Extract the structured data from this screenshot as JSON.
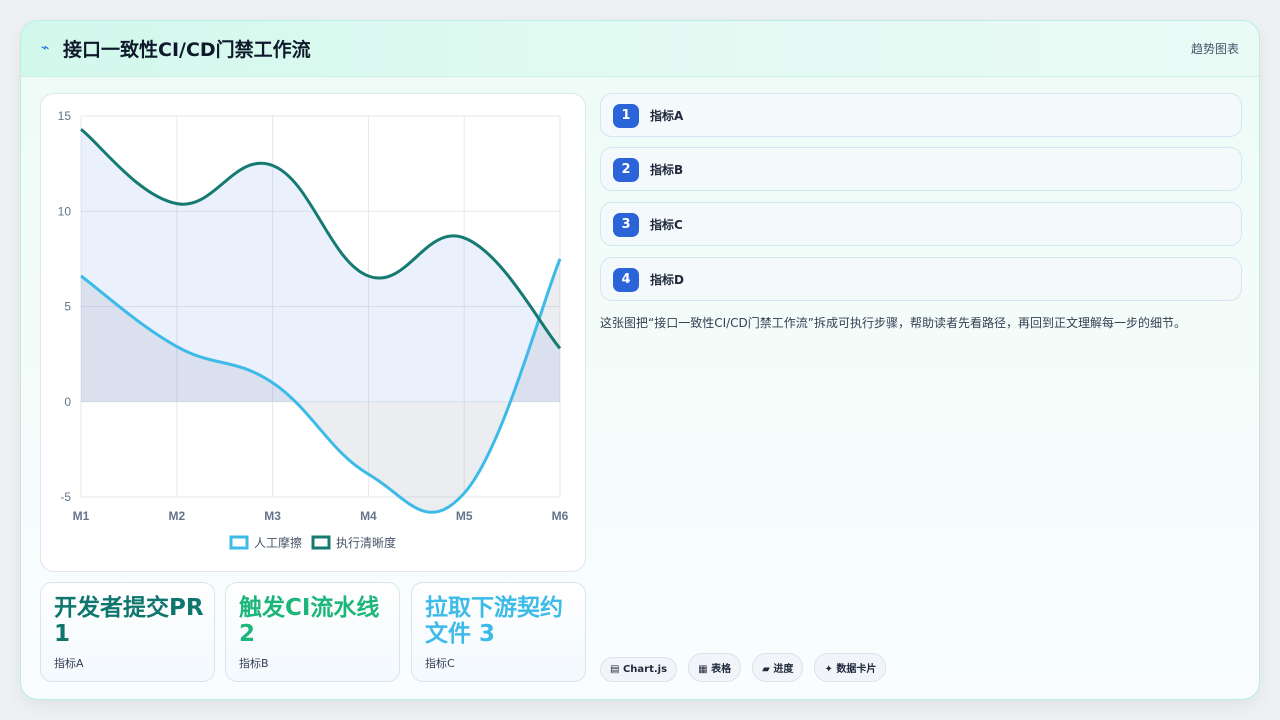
{
  "header": {
    "icon": "bolt-icon",
    "title": "接口一致性CI/CD门禁工作流",
    "tag": "趋势图表"
  },
  "chart_data": {
    "type": "line",
    "categories": [
      "M1",
      "M2",
      "M3",
      "M4",
      "M5",
      "M6"
    ],
    "series": [
      {
        "name": "人工摩擦",
        "values": [
          6.6,
          2.9,
          1.0,
          -3.8,
          -4.8,
          7.5
        ],
        "color": "#3dbbe8",
        "fill": "rgba(120,130,150,0.14)"
      },
      {
        "name": "执行清晰度",
        "values": [
          14.3,
          10.4,
          12.4,
          6.6,
          8.6,
          2.8
        ],
        "color": "#147a72",
        "fill": "rgba(130,160,240,0.16)"
      }
    ],
    "ylim": [
      -5,
      15
    ],
    "yticks": [
      15,
      10,
      5,
      0,
      -5
    ],
    "grid": true,
    "legend": "bottom"
  },
  "stats": [
    {
      "value": "开发者提交PR 1",
      "label": "指标A",
      "color": "#0f766e"
    },
    {
      "value": "触发CI流水线 2",
      "label": "指标B",
      "color": "#1db67a"
    },
    {
      "value": "拉取下游契约文件 3",
      "label": "指标C",
      "color": "#3dbbe8"
    }
  ],
  "steps": [
    {
      "num": "1",
      "label": "指标A"
    },
    {
      "num": "2",
      "label": "指标B"
    },
    {
      "num": "3",
      "label": "指标C"
    },
    {
      "num": "4",
      "label": "指标D"
    }
  ],
  "description": "这张图把“接口一致性CI/CD门禁工作流”拆成可执行步骤，帮助读者先看路径，再回到正文理解每一步的细节。",
  "pills": [
    {
      "icon": "chart-icon",
      "glyph": "▤",
      "label": "Chart.js"
    },
    {
      "icon": "table-icon",
      "glyph": "▦",
      "label": "表格"
    },
    {
      "icon": "progress-icon",
      "glyph": "▰",
      "label": "进度"
    },
    {
      "icon": "card-icon",
      "glyph": "✦",
      "label": "数据卡片"
    }
  ]
}
